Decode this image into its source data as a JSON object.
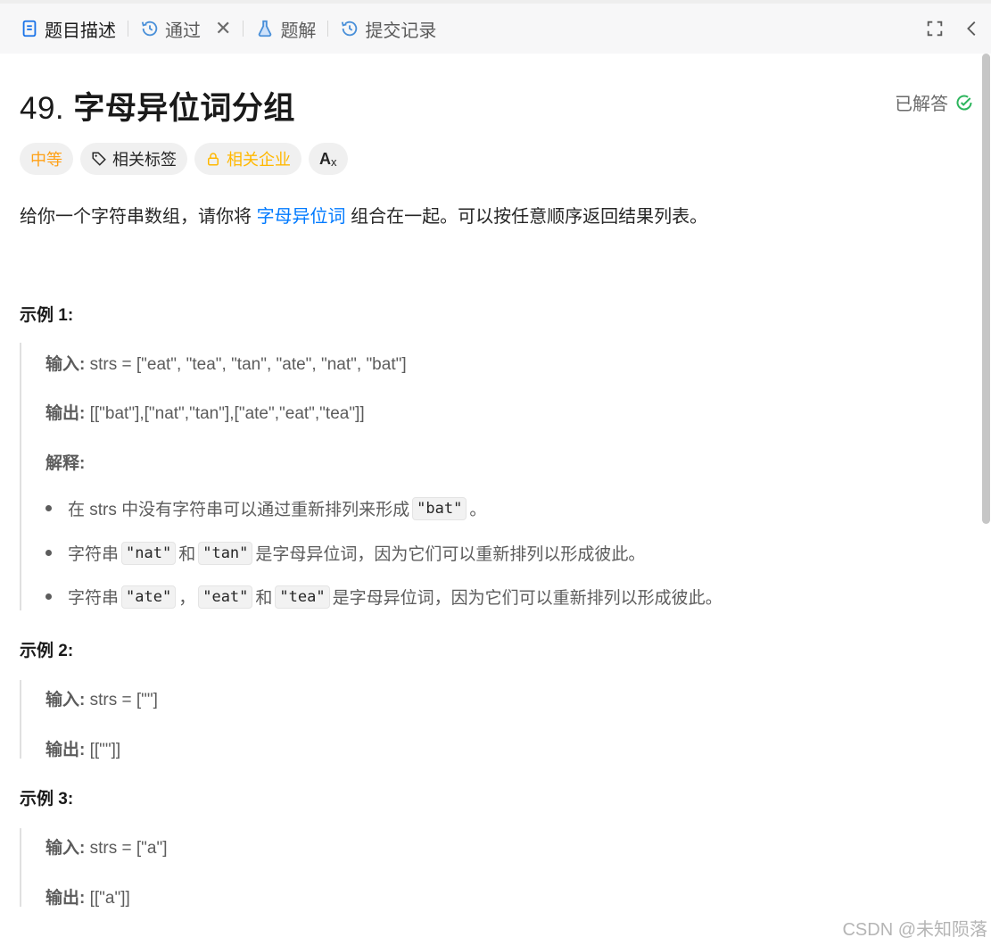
{
  "tabs": [
    {
      "label": "题目描述",
      "icon": "document-icon"
    },
    {
      "label": "通过",
      "icon": "history-icon"
    },
    {
      "label": "题解",
      "icon": "flask-icon"
    },
    {
      "label": "提交记录",
      "icon": "history-icon"
    }
  ],
  "tab_close": "✕",
  "problem": {
    "number": "49.",
    "title": "字母异位词分组",
    "status": "已解答"
  },
  "tags": {
    "difficulty": "中等",
    "related_tags": "相关标签",
    "related_companies": "相关企业",
    "translate": "A"
  },
  "description": {
    "before": "给你一个字符串数组，请你将 ",
    "link": "字母异位词",
    "after": " 组合在一起。可以按任意顺序返回结果列表。"
  },
  "examples": [
    {
      "title": "示例 1:",
      "input_label": "输入:",
      "input": " strs = [\"eat\", \"tea\", \"tan\", \"ate\", \"nat\", \"bat\"]",
      "output_label": "输出:",
      "output": " [[\"bat\"],[\"nat\",\"tan\"],[\"ate\",\"eat\",\"tea\"]]",
      "explain_label": "解释:",
      "bullets": {
        "b1_pre": "在 strs 中没有字符串可以通过重新排列来形成 ",
        "b1_code": "\"bat\"",
        "b1_post": "。",
        "b2_pre": "字符串 ",
        "b2_code1": "\"nat\"",
        "b2_mid": " 和 ",
        "b2_code2": "\"tan\"",
        "b2_post": " 是字母异位词，因为它们可以重新排列以形成彼此。",
        "b3_pre": "字符串 ",
        "b3_code1": "\"ate\"",
        "b3_sep": " ，",
        "b3_code2": "\"eat\"",
        "b3_mid": " 和 ",
        "b3_code3": "\"tea\"",
        "b3_post": " 是字母异位词，因为它们可以重新排列以形成彼此。"
      }
    },
    {
      "title": "示例 2:",
      "input_label": "输入:",
      "input": " strs = [\"\"]",
      "output_label": "输出:",
      "output": " [[\"\"]]"
    },
    {
      "title": "示例 3:",
      "input_label": "输入:",
      "input": " strs = [\"a\"]",
      "output_label": "输出:",
      "output": " [[\"a\"]]"
    }
  ],
  "watermark": "CSDN @未知陨落",
  "colors": {
    "link": "#007aff",
    "difficulty": "#ffa116",
    "company": "#ffb800",
    "solved_check": "#2db55d"
  }
}
